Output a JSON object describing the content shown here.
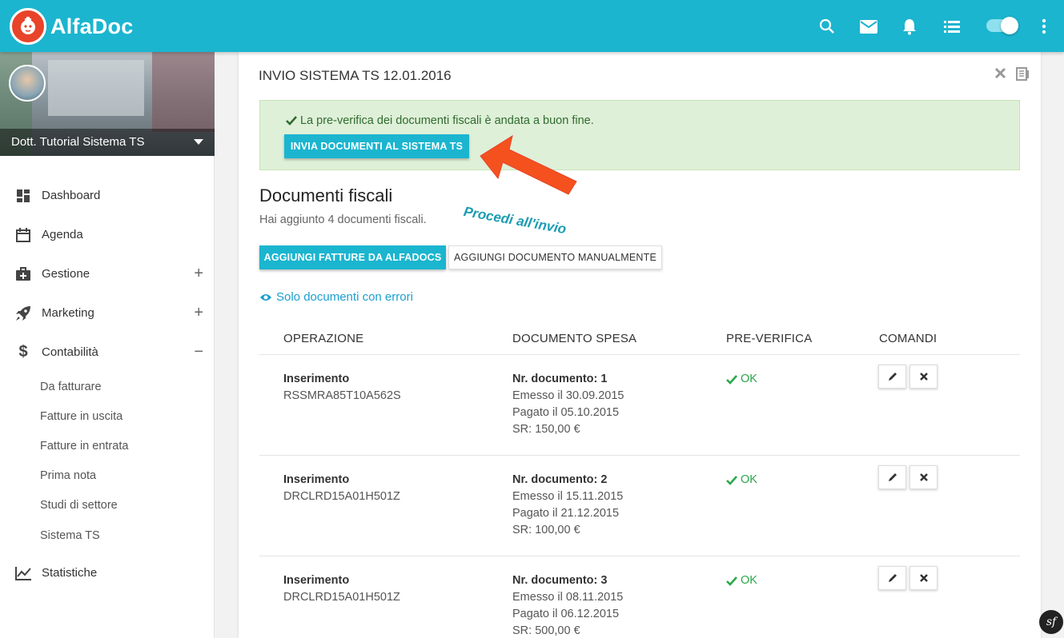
{
  "app": {
    "name": "AlfaDoc"
  },
  "topbar": {
    "icons": [
      "search-icon",
      "mail-icon",
      "bell-icon",
      "list-icon",
      "toggle",
      "more-vert-icon"
    ]
  },
  "sidebar": {
    "user_name": "Dott. Tutorial Sistema TS",
    "items": [
      {
        "label": "Dashboard",
        "icon": "dashboard-icon"
      },
      {
        "label": "Agenda",
        "icon": "calendar-icon"
      },
      {
        "label": "Gestione",
        "icon": "medkit-icon",
        "expander": "+"
      },
      {
        "label": "Marketing",
        "icon": "rocket-icon",
        "expander": "+"
      },
      {
        "label": "Contabilità",
        "icon": "dollar-icon",
        "expander": "−"
      }
    ],
    "subitems": [
      "Da fatturare",
      "Fatture in uscita",
      "Fatture in entrata",
      "Prima nota",
      "Studi di settore",
      "Sistema TS"
    ],
    "bottom_item": {
      "label": "Statistiche",
      "icon": "chart-icon"
    }
  },
  "card": {
    "title": "INVIO SISTEMA TS 12.01.2016",
    "alert_text": "La pre-verifica dei documenti fiscali è andata a buon fine.",
    "send_button": "INVIA DOCUMENTI AL SISTEMA TS",
    "section_title": "Documenti fiscali",
    "section_subtitle": "Hai aggiunto 4 documenti fiscali.",
    "add_alfadocs_button": "AGGIUNGI FATTURE DA ALFADOCS",
    "add_manual_button": "AGGIUNGI DOCUMENTO MANUALMENTE",
    "filter_link": "Solo documenti con errori",
    "annotation": "Procedi all'invio"
  },
  "table": {
    "headers": [
      "OPERAZIONE",
      "DOCUMENTO SPESA",
      "PRE-VERIFICA",
      "COMANDI"
    ],
    "rows": [
      {
        "operation": "Inserimento",
        "code": "RSSMRA85T10A562S",
        "doc": "Nr. documento: 1",
        "issued": "Emesso il 30.09.2015",
        "paid": "Pagato il 05.10.2015",
        "sr": "SR: 150,00 €",
        "status": "OK"
      },
      {
        "operation": "Inserimento",
        "code": "DRCLRD15A01H501Z",
        "doc": "Nr. documento: 2",
        "issued": "Emesso il 15.11.2015",
        "paid": "Pagato il 21.12.2015",
        "sr": "SR: 100,00 €",
        "status": "OK"
      },
      {
        "operation": "Inserimento",
        "code": "DRCLRD15A01H501Z",
        "doc": "Nr. documento: 3",
        "issued": "Emesso il 08.11.2015",
        "paid": "Pagato il 06.12.2015",
        "sr": "SR: 500,00 €",
        "status": "OK"
      }
    ]
  },
  "colors": {
    "primary": "#1bb5cf",
    "success": "#2aa84a",
    "alert_bg": "#dff0d8",
    "annotation_arrow": "#f4511e"
  }
}
